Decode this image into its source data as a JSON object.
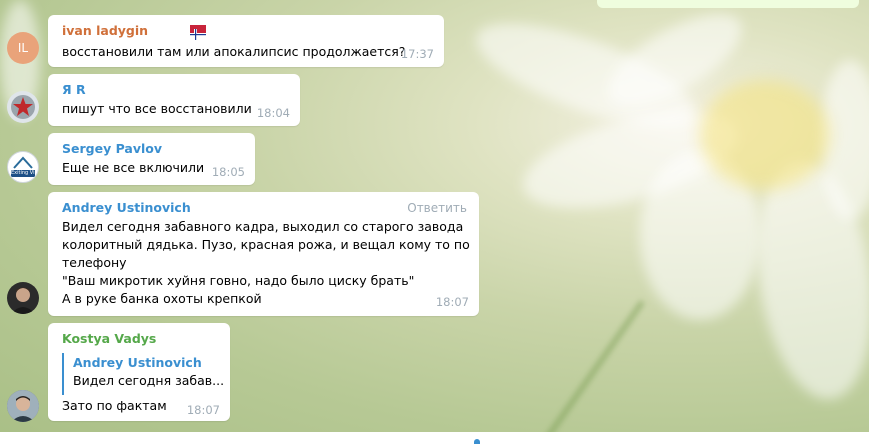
{
  "colors": {
    "name_ivan": "#d0703a",
    "name_blue": "#3a8fd0",
    "name_green": "#55a84a",
    "time": "#a0acb6",
    "bubble": "#ffffff"
  },
  "messages": [
    {
      "avatar_initials": "IL",
      "author": "ivan ladygin",
      "flag_icon": "norway-flag-icon",
      "lines": "восстановили там или апокалипсис продолжается?",
      "time": "17:37"
    },
    {
      "avatar_icon": "red-star-emblem-icon",
      "author": "Я R",
      "lines": "пишут что все восстановили",
      "time": "18:04"
    },
    {
      "avatar_icon": "exiting-vim-logo-icon",
      "avatar_caption": "Exiting Vim",
      "author": "Sergey Pavlov",
      "lines": "Еще не все включили",
      "time": "18:05"
    },
    {
      "avatar_icon": "user-photo-icon",
      "author": "Andrey Ustinovich",
      "reply_label": "Ответить",
      "lines": "Видел сегодня забавного кадра, выходил со старого завода\nколоритный дядька. Пузо, красная рожа, и вещал кому то по\nтелефону\n\"Ваш микротик хуйня говно, надо было циску брать\"\nА в руке банка охоты крепкой",
      "time": "18:07"
    },
    {
      "avatar_icon": "user-photo-icon",
      "author": "Kostya Vadys",
      "quote_author": "Andrey Ustinovich",
      "quote_text": "Видел сегодня забав...",
      "lines": "Зато по фактам",
      "time": "18:07"
    }
  ]
}
